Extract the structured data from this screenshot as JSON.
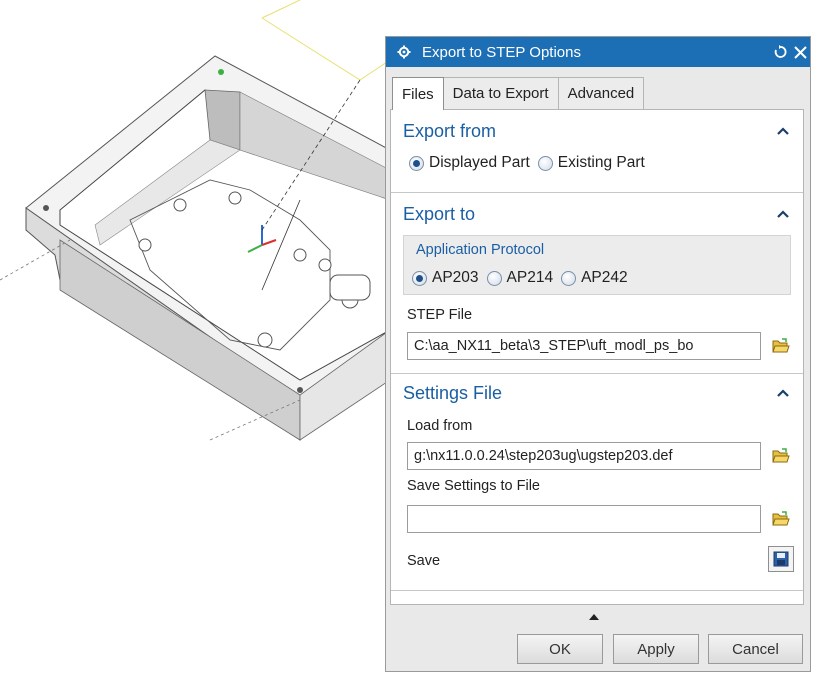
{
  "dialog": {
    "title": "Export to STEP Options",
    "tabs": [
      {
        "label": "Files",
        "active": true
      },
      {
        "label": "Data to Export",
        "active": false
      },
      {
        "label": "Advanced",
        "active": false
      }
    ]
  },
  "export_from": {
    "header": "Export from",
    "options": [
      {
        "label": "Displayed Part",
        "selected": true
      },
      {
        "label": "Existing Part",
        "selected": false
      }
    ]
  },
  "export_to": {
    "header": "Export to",
    "group_title": "Application Protocol",
    "options": [
      {
        "label": "AP203",
        "selected": true
      },
      {
        "label": "AP214",
        "selected": false
      },
      {
        "label": "AP242",
        "selected": false
      }
    ],
    "step_file_label": "STEP File",
    "step_file_value": "C:\\aa_NX11_beta\\3_STEP\\uft_modl_ps_bo"
  },
  "settings": {
    "header": "Settings File",
    "load_label": "Load from",
    "load_value": "g:\\nx11.0.0.24\\step203ug\\ugstep203.def",
    "save_settings_label": "Save Settings to File",
    "save_settings_value": "",
    "save_label": "Save"
  },
  "buttons": {
    "ok": "OK",
    "apply": "Apply",
    "cancel": "Cancel"
  },
  "colors": {
    "title_bar": "#1d6fb5",
    "section_header": "#1a5fa3"
  },
  "icons": [
    "gear-icon",
    "reset-icon",
    "close-icon",
    "chevron-up-icon",
    "folder-open-icon",
    "save-disk-icon"
  ]
}
